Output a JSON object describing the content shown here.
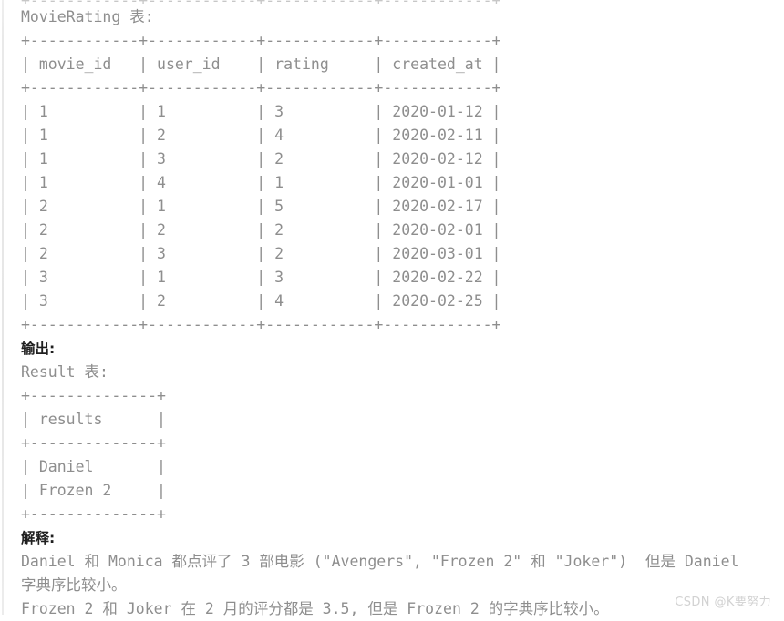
{
  "top_clip_text": "+------------+------------+------------+------------+",
  "movie_rating": {
    "caption": "MovieRating 表:",
    "rule": "+------------+------------+------------+------------+",
    "header_line": "| movie_id   | user_id    | rating     | created_at |",
    "columns": [
      "movie_id",
      "user_id",
      "rating",
      "created_at"
    ],
    "rows": [
      [
        "1",
        "1",
        "3",
        "2020-01-12"
      ],
      [
        "1",
        "2",
        "4",
        "2020-02-11"
      ],
      [
        "1",
        "3",
        "2",
        "2020-02-12"
      ],
      [
        "1",
        "4",
        "1",
        "2020-01-01"
      ],
      [
        "2",
        "1",
        "5",
        "2020-02-17"
      ],
      [
        "2",
        "2",
        "2",
        "2020-02-01"
      ],
      [
        "2",
        "3",
        "2",
        "2020-03-01"
      ],
      [
        "3",
        "1",
        "3",
        "2020-02-22"
      ],
      [
        "3",
        "2",
        "4",
        "2020-02-25"
      ]
    ],
    "row_lines": [
      "| 1          | 1          | 3          | 2020-01-12 |",
      "| 1          | 2          | 4          | 2020-02-11 |",
      "| 1          | 3          | 2          | 2020-02-12 |",
      "| 1          | 4          | 1          | 2020-01-01 |",
      "| 2          | 1          | 5          | 2020-02-17 |",
      "| 2          | 2          | 2          | 2020-02-01 |",
      "| 2          | 3          | 2          | 2020-03-01 |",
      "| 3          | 1          | 3          | 2020-02-22 |",
      "| 3          | 2          | 4          | 2020-02-25 |"
    ]
  },
  "output": {
    "heading": "输出:",
    "caption": "Result 表:",
    "rule": "+--------------+",
    "header_line": "| results      |",
    "columns": [
      "results"
    ],
    "rows": [
      [
        "Daniel"
      ],
      [
        "Frozen 2"
      ]
    ],
    "row_lines": [
      "| Daniel       |",
      "| Frozen 2     |"
    ]
  },
  "explanation": {
    "heading": "解释:",
    "lines": [
      "Daniel 和 Monica 都点评了 3 部电影 (\"Avengers\", \"Frozen 2\" 和 \"Joker\")  但是 Daniel",
      "字典序比较小。",
      "Frozen 2 和 Joker 在 2 月的评分都是 3.5, 但是 Frozen 2 的字典序比较小。"
    ]
  },
  "watermark": "CSDN @K要努力",
  "colors": {
    "mono_text": "#8e8e8e",
    "heading_text": "#1f1f1f",
    "left_rule": "#e6e6e6",
    "watermark": "#d2d2d2",
    "background": "#ffffff"
  }
}
